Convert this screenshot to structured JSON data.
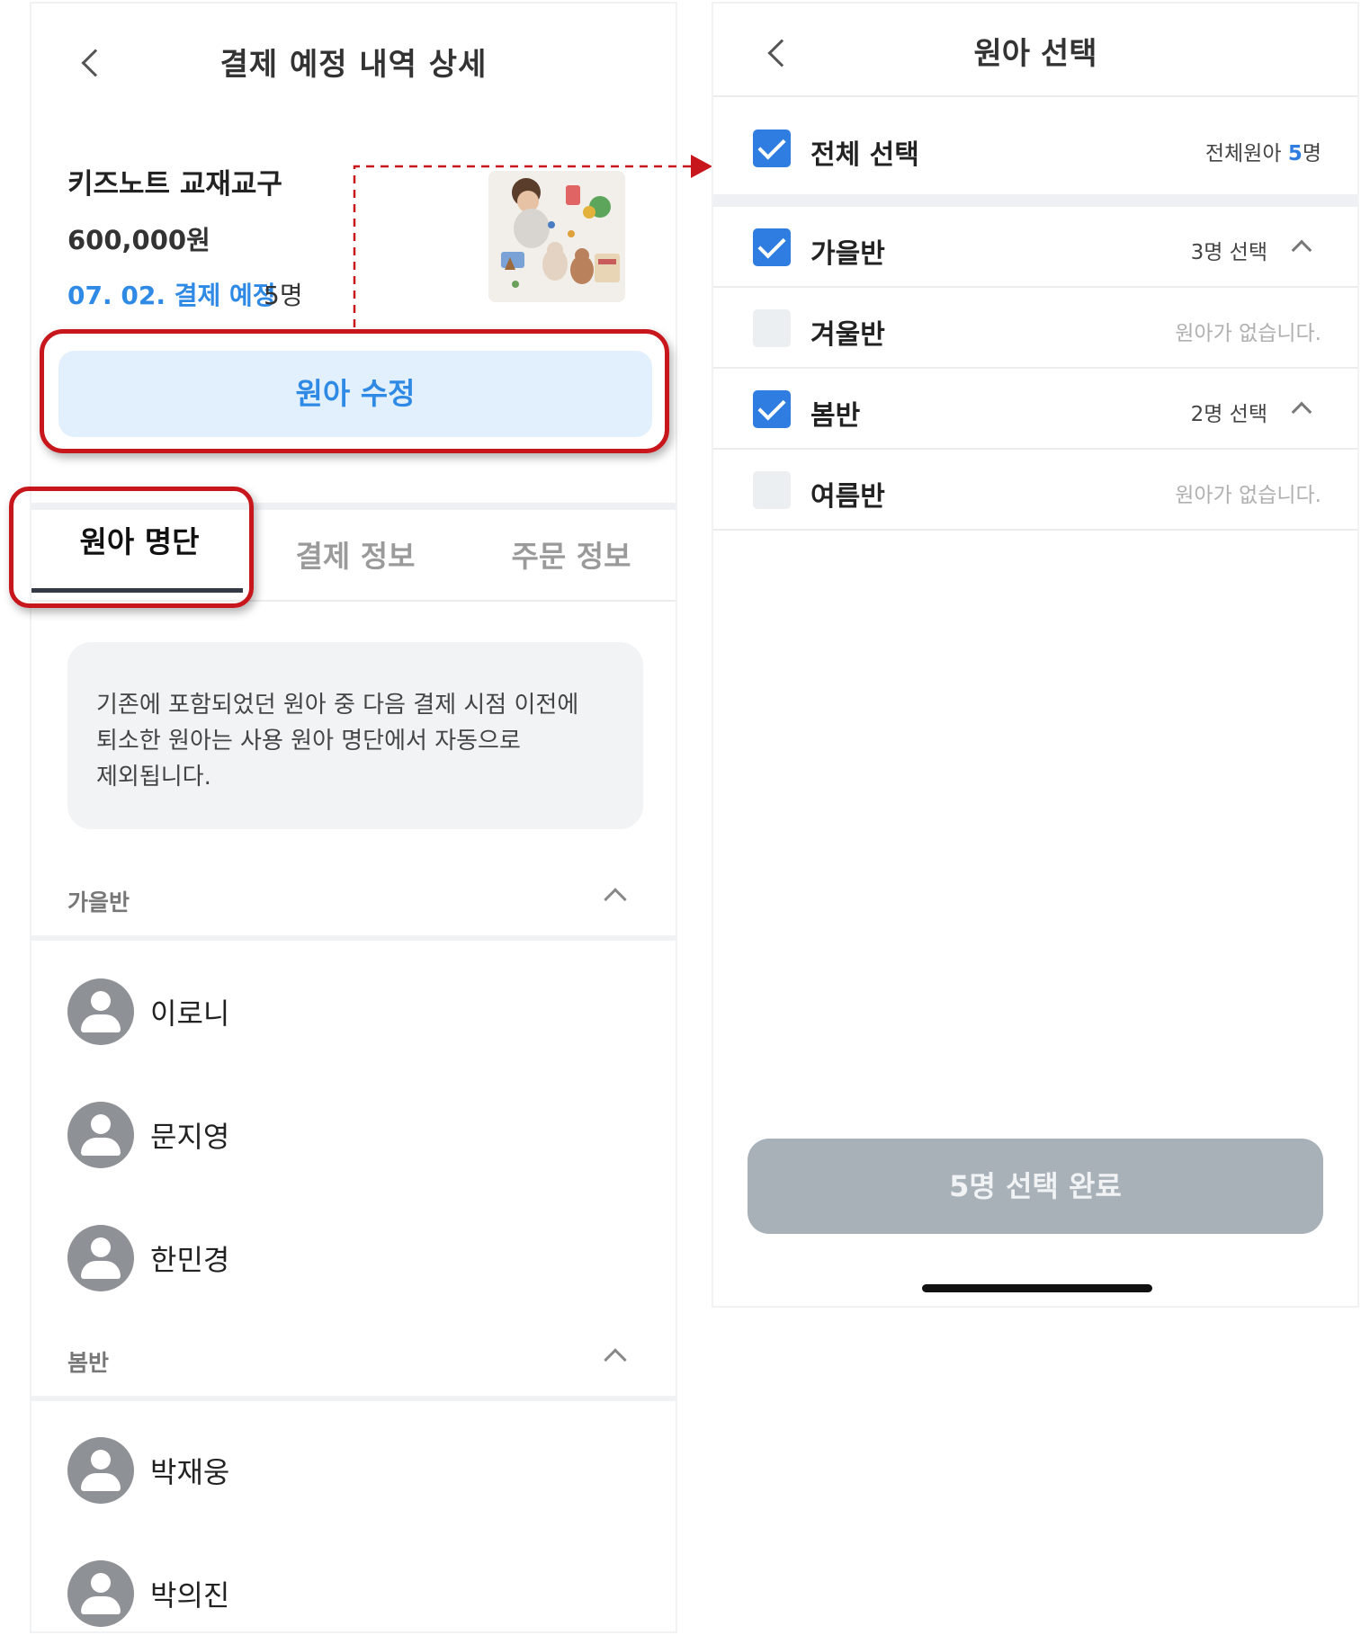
{
  "left": {
    "header": {
      "title": "결제 예정 내역 상세"
    },
    "product": {
      "name": "키즈노트 교재교구",
      "price": "600,000원",
      "date_status": "07. 02. 결제 예정",
      "count": "5명"
    },
    "edit_button": "원아 수정",
    "tabs": [
      {
        "label": "원아 명단",
        "active": true
      },
      {
        "label": "결제 정보",
        "active": false
      },
      {
        "label": "주문 정보",
        "active": false
      }
    ],
    "notice_lines": [
      "기존에 포함되었던 원아 중 다음 결제 시점 이전에",
      "퇴소한 원아는 사용 원아 명단에서 자동으로",
      "제외됩니다."
    ],
    "groups": [
      {
        "label": "가을반",
        "members": [
          "이로니",
          "문지영",
          "한민경"
        ]
      },
      {
        "label": "봄반",
        "members": [
          "박재웅",
          "박의진"
        ]
      }
    ]
  },
  "right": {
    "header": {
      "title": "원아 선택"
    },
    "select_all": {
      "label": "전체 선택",
      "info_prefix": "전체원아 ",
      "count": "5",
      "info_suffix": "명",
      "checked": true
    },
    "classes": [
      {
        "label": "가을반",
        "info": "3명 선택",
        "checked": true,
        "expanded": true
      },
      {
        "label": "겨울반",
        "info": "원아가 없습니다.",
        "checked": false
      },
      {
        "label": "봄반",
        "info": "2명 선택",
        "checked": true,
        "expanded": true
      },
      {
        "label": "여름반",
        "info": "원아가 없습니다.",
        "checked": false
      }
    ],
    "done_button": "5명 선택 완료"
  },
  "colors": {
    "accent_blue": "#2f8ae6",
    "checkbox_blue": "#2f7de1",
    "highlight_red": "#c8161d",
    "disabled_button": "#a8b0b8"
  },
  "icons": [
    "back-chevron-icon",
    "chevron-up-icon",
    "checkbox-icon",
    "avatar-icon"
  ]
}
